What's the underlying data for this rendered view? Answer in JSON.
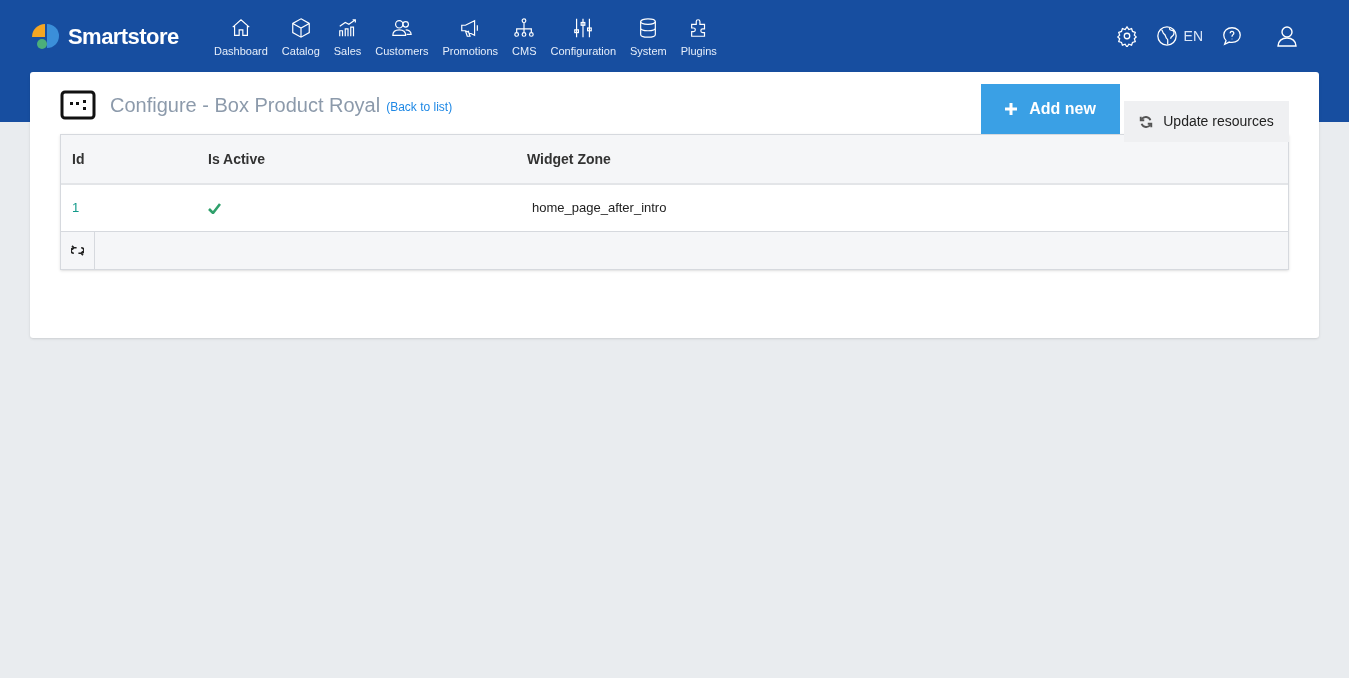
{
  "brand": {
    "name": "Smartstore"
  },
  "nav": [
    {
      "label": "Dashboard"
    },
    {
      "label": "Catalog"
    },
    {
      "label": "Sales"
    },
    {
      "label": "Customers"
    },
    {
      "label": "Promotions"
    },
    {
      "label": "CMS"
    },
    {
      "label": "Configuration"
    },
    {
      "label": "System"
    },
    {
      "label": "Plugins"
    }
  ],
  "language": "EN",
  "page": {
    "title": "Configure - Box Product Royal",
    "back_link": "(Back to list)"
  },
  "buttons": {
    "add_new": "Add new",
    "update_resources": "Update resources"
  },
  "table": {
    "columns": [
      "Id",
      "Is Active",
      "Widget Zone"
    ],
    "rows": [
      {
        "id": "1",
        "active": true,
        "widget_zone": "home_page_after_intro"
      }
    ]
  }
}
